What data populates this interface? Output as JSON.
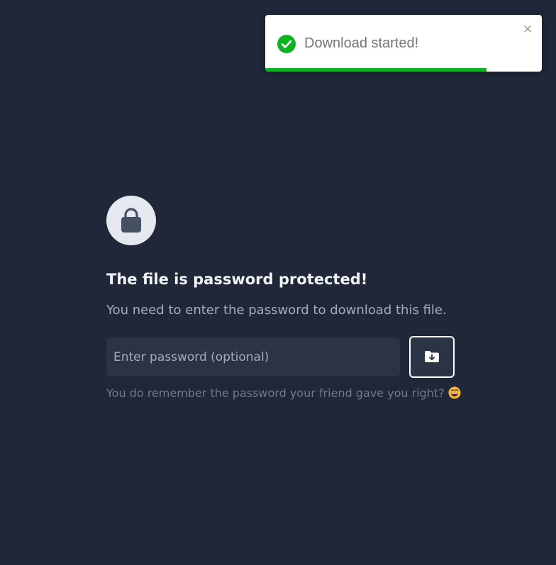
{
  "toast": {
    "message": "Download started!",
    "close_symbol": "×",
    "progress_fraction": 0.8,
    "icon": "check-circle-icon",
    "colors": {
      "success": "#0fb321",
      "progress": "#0fb321"
    }
  },
  "main": {
    "icon": "lock-icon",
    "title": "The file is password protected!",
    "subtitle": "You need to enter the password to download this file.",
    "password_placeholder": "Enter password (optional)",
    "password_value": "",
    "download_button_icon": "folder-download-icon",
    "hint": "You do remember the password your friend gave you right?",
    "hint_emoji": "grinning-sweat-emoji"
  },
  "colors": {
    "background": "#1f2738",
    "input_background": "#2b3445",
    "title": "#f1f3f7",
    "subtitle": "#a3adc0",
    "hint": "#6e7a8f"
  }
}
